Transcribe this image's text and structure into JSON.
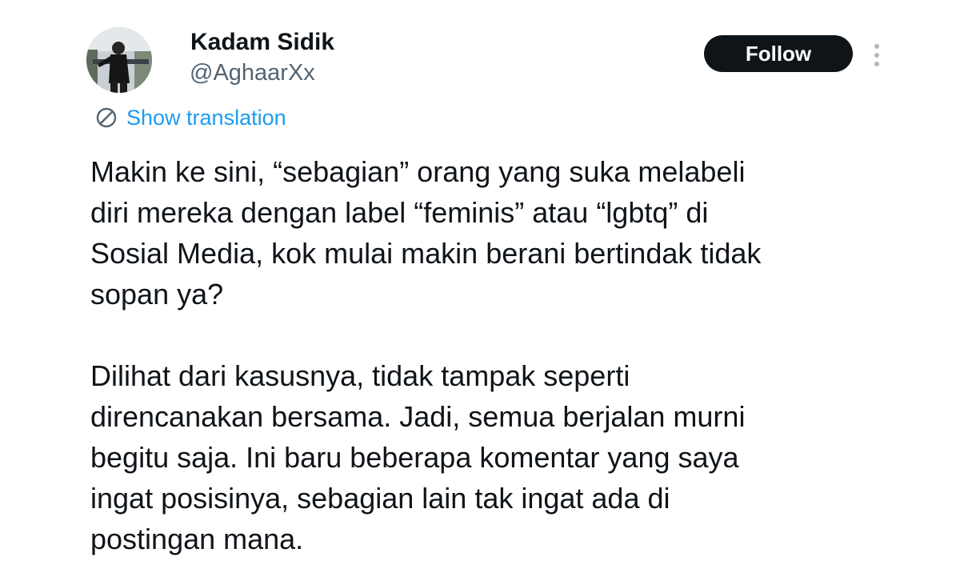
{
  "author": {
    "display_name": "Kadam Sidik",
    "handle": "@AghaarXx"
  },
  "actions": {
    "follow_label": "Follow",
    "more_icon": "more-vertical-icon"
  },
  "translation": {
    "label": "Show translation",
    "icon": "globe-icon"
  },
  "post": {
    "paragraph1": [
      "Makin ke sini, “sebagian” orang yang suka melabeli",
      "diri mereka dengan label “feminis” atau “lgbtq” di",
      "Sosial Media, kok mulai makin berani bertindak tidak",
      "sopan ya?"
    ],
    "paragraph2": [
      "Dilihat dari kasusnya, tidak tampak seperti",
      "direncanakan bersama. Jadi, semua berjalan murni",
      "begitu saja. Ini baru beberapa komentar yang saya",
      "ingat posisinya, sebagian lain tak ingat ada di",
      "postingan mana."
    ]
  },
  "colors": {
    "text": "#0f1419",
    "secondary": "#536471",
    "link": "#1d9bf0",
    "button_bg": "#0f1419",
    "button_text": "#ffffff"
  }
}
